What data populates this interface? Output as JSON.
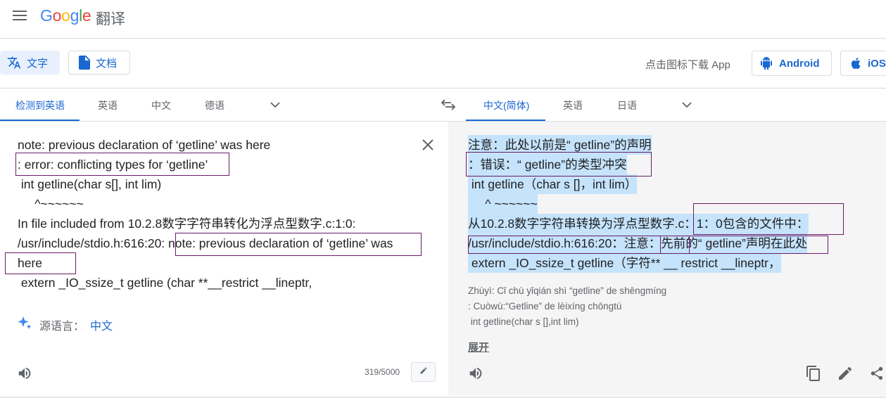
{
  "header": {
    "logo_letters": [
      "G",
      "o",
      "o",
      "g",
      "l",
      "e"
    ],
    "product": "翻译"
  },
  "modes": {
    "text": "文字",
    "documents": "文档"
  },
  "app_promo": {
    "label": "点击图标下载 App",
    "android": "Android",
    "ios": "iOS"
  },
  "source_langs": {
    "detected": "检测到英语",
    "items": [
      "英语",
      "中文",
      "德语"
    ]
  },
  "target_langs": {
    "active": "中文(简体)",
    "items": [
      "英语",
      "日语"
    ]
  },
  "source": {
    "lines": [
      "note: previous declaration of ‘getline’ was here",
      ": error: conflicting types for ‘getline’",
      " int getline(char s[], int lim)",
      "     ^~~~~~~",
      "In file included from 10.2.8数字字符串转化为浮点型数字.c:1:0:",
      "/usr/include/stdio.h:616:20: note: previous declaration of ‘getline’ was",
      "here",
      " extern _IO_ssize_t getline (char **__restrict __lineptr,"
    ],
    "detected_label": "源语言：",
    "detected_value": "中文",
    "char_count": "319/5000"
  },
  "target": {
    "lines": [
      "注意：此处以前是“ getline”的声明",
      "：错误：“ getline”的类型冲突",
      " int getline（char s []，int lim）",
      "     ^ ~~~~~~",
      "从10.2.8数字字符串转换为浮点型数字.c：1：0包含的文件中：",
      "/usr/include/stdio.h:616:20：注意：先前的“ getline”声明在此处",
      " extern _IO_ssize_t getline（字符** __ restrict __lineptr，"
    ],
    "romanization": [
      "Zhùyì: Cǐ chù yǐqián shì “getline” de shēngmíng",
      ": Cuòwù:“Getline” de lèixíng chōngtú",
      " int getline(char s [],int lim)"
    ],
    "expand": "展开"
  },
  "colors": {
    "accent": "#1967d2",
    "highlight": "#c5e3fb",
    "annotation_box": "#6a1b6a"
  },
  "icons": [
    "menu-icon",
    "translate-icon",
    "document-icon",
    "android-icon",
    "apple-icon",
    "chevron-down-icon",
    "swap-icon",
    "close-icon",
    "sparkle-icon",
    "speaker-icon",
    "pencil-icon",
    "copy-icon",
    "share-icon"
  ]
}
